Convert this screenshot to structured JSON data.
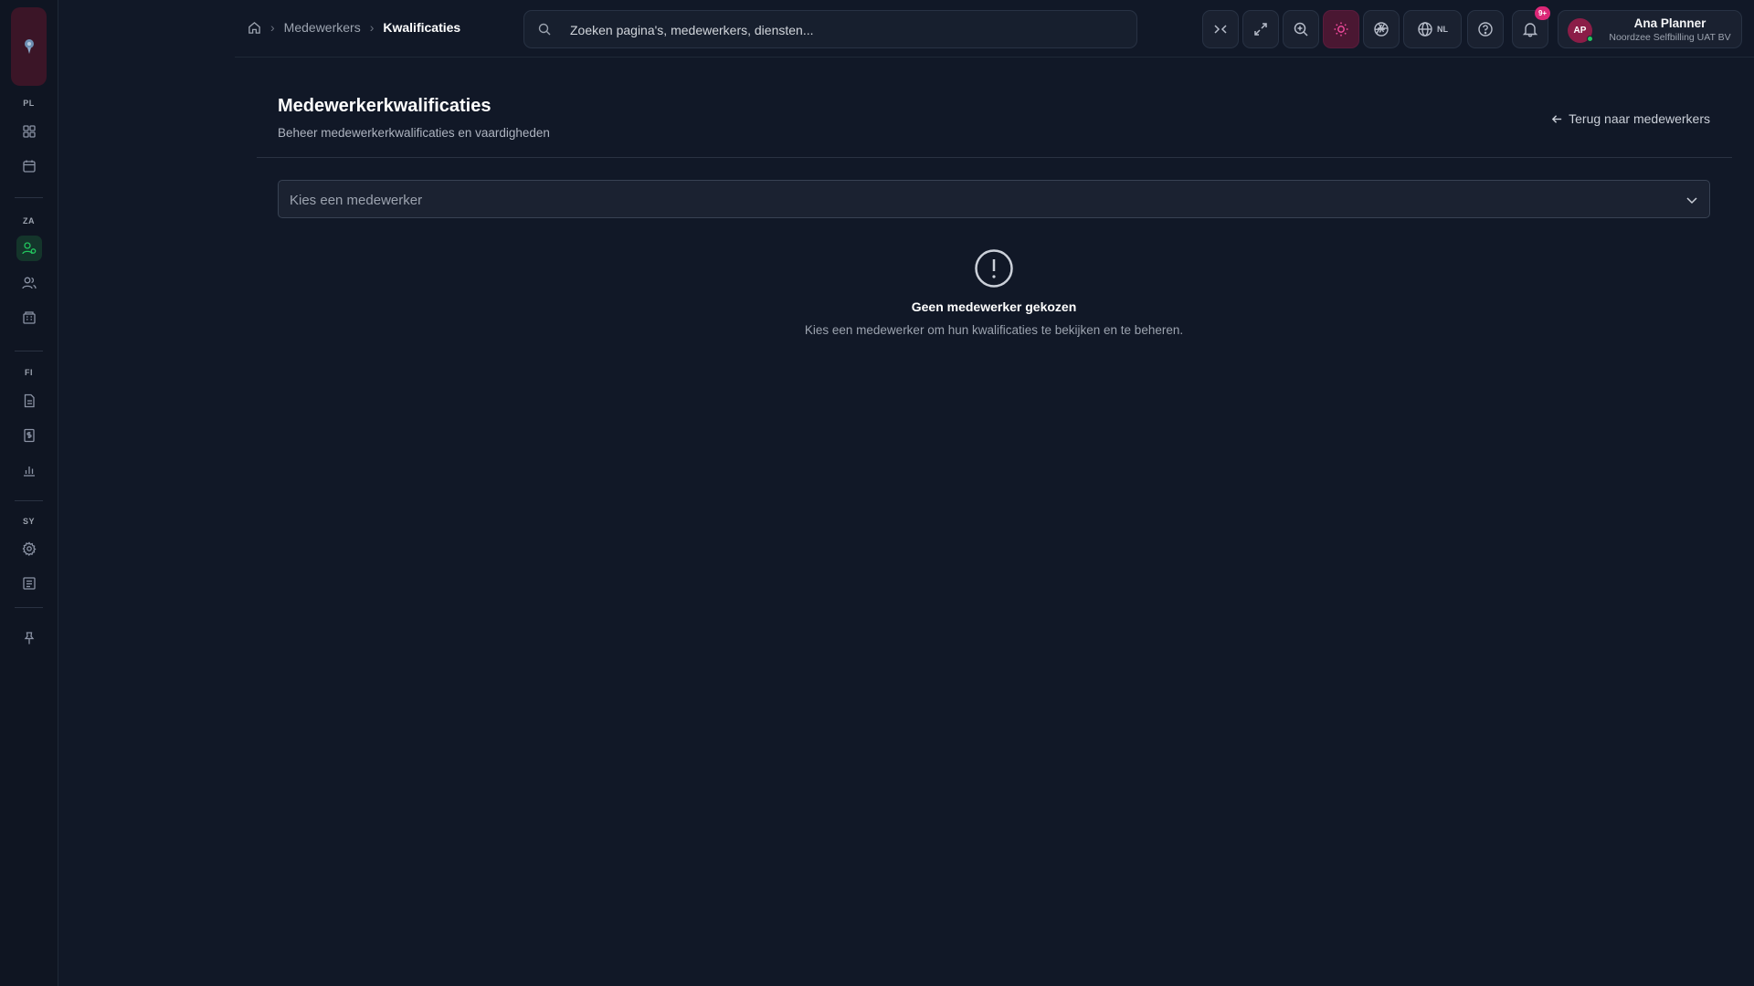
{
  "sidebar": {
    "sections": [
      {
        "label": "PL",
        "items": [
          {
            "icon": "dashboard-icon"
          },
          {
            "icon": "calendar-icon"
          }
        ]
      },
      {
        "label": "ZA",
        "items": [
          {
            "icon": "user-qualification-icon",
            "active": true
          },
          {
            "icon": "users-icon"
          },
          {
            "icon": "building-icon"
          }
        ]
      },
      {
        "label": "FI",
        "items": [
          {
            "icon": "document-icon"
          },
          {
            "icon": "invoice-icon"
          },
          {
            "icon": "bar-chart-icon"
          }
        ]
      },
      {
        "label": "SY",
        "items": [
          {
            "icon": "gear-icon"
          },
          {
            "icon": "log-icon"
          }
        ]
      }
    ],
    "pin_icon": "pin-icon"
  },
  "breadcrumb": {
    "home_icon": "home-icon",
    "items": [
      "Medewerkers",
      "Kwalificaties"
    ]
  },
  "search": {
    "placeholder": "Zoeken pagina's, medewerkers, diensten..."
  },
  "toolbar": {
    "buttons": [
      "collapse-icon",
      "expand-icon",
      "zoom-in-icon",
      "sun-icon",
      "aperture-icon",
      "globe-icon",
      "help-icon",
      "bell-icon"
    ],
    "language": "NL",
    "notification_badge": "9+"
  },
  "user": {
    "initials": "AP",
    "name": "Ana Planner",
    "organization": "Noordzee Selfbilling UAT BV"
  },
  "page": {
    "title": "Medewerkerkwalificaties",
    "subtitle": "Beheer medewerkerkwalificaties en vaardigheden",
    "back_link": "Terug naar medewerkers"
  },
  "employee_select": {
    "placeholder": "Kies een medewerker"
  },
  "empty_state": {
    "title": "Geen medewerker gekozen",
    "description": "Kies een medewerker om hun kwalificaties te bekijken en te beheren."
  },
  "colors": {
    "background": "#111827",
    "accent_pink": "#ec4899",
    "active_green": "#22c55e"
  }
}
